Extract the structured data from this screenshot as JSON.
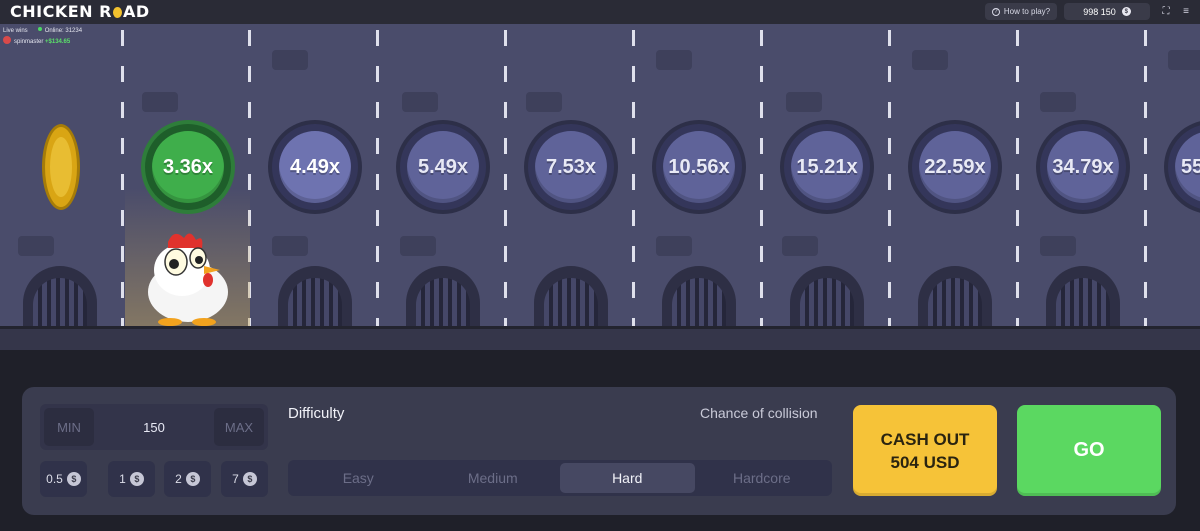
{
  "header": {
    "logo_text_1": "CHICKEN R",
    "logo_text_2": "AD",
    "how_to_play": "How to play?",
    "balance": "998 150",
    "currency_icon": "dollar-coin-icon",
    "fullscreen_icon": "fullscreen-icon",
    "menu_icon": "hamburger-menu-icon"
  },
  "live_wins": {
    "label": "Live wins",
    "online_label": "Online: 31234",
    "player": "spinmaster",
    "amount": "+$134.65"
  },
  "road": {
    "multipliers": [
      "3.36x",
      "4.49x",
      "5.49x",
      "7.53x",
      "10.56x",
      "15.21x",
      "22.59x",
      "34.79x",
      "55"
    ],
    "active_index": 0,
    "next_index": 1
  },
  "controls": {
    "min_label": "MIN",
    "max_label": "MAX",
    "bet_amount": "150",
    "quick_bets": [
      "0.5",
      "1",
      "2",
      "7"
    ],
    "difficulty_label": "Difficulty",
    "collision_label": "Chance of collision",
    "difficulties": [
      "Easy",
      "Medium",
      "Hard",
      "Hardcore"
    ],
    "selected_difficulty": "Hard",
    "cashout_line1": "CASH OUT",
    "cashout_line2": "504 USD",
    "go_label": "GO"
  },
  "colors": {
    "active_coin": "#3fae4b",
    "coin": "#5f6399",
    "cashout": "#f6c338",
    "go": "#5bd861"
  }
}
